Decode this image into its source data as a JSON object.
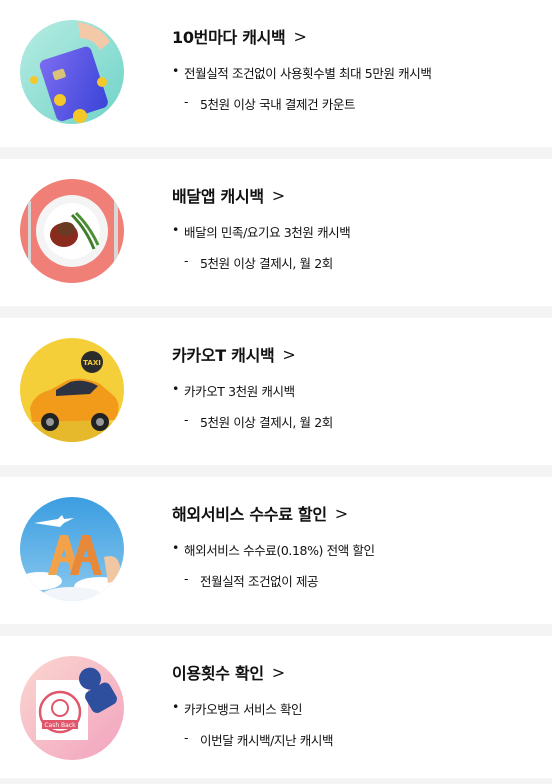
{
  "items": [
    {
      "title": "10번마다 캐시백",
      "chevron": ">",
      "bullet": "전월실적 조건없이 사용횟수별 최대 5만원 캐시백",
      "sub": "5천원 이상 국내 결제건 카운트",
      "icon": "card-cashback-icon"
    },
    {
      "title": "배달앱 캐시백",
      "chevron": ">",
      "bullet": "배달의 민족/요기요 3천원 캐시백",
      "sub": "5천원 이상 결제시, 월 2회",
      "icon": "food-plate-icon"
    },
    {
      "title": "카카오T 캐시백",
      "chevron": ">",
      "bullet": "카카오T 3천원 캐시백",
      "sub": "5천원 이상 결제시, 월 2회",
      "icon": "taxi-icon",
      "taxi_label": "TAXI"
    },
    {
      "title": "해외서비스 수수료 할인",
      "chevron": ">",
      "bullet": "해외서비스 수수료(0.18%) 전액 할인",
      "sub": "전월실적 조건없이 제공",
      "icon": "airplane-aa-icon"
    },
    {
      "title": "이용횟수 확인",
      "chevron": ">",
      "bullet": "카카오뱅크 서비스 확인",
      "sub": "이번달 캐시백/지난 캐시백",
      "icon": "cashback-stamp-icon",
      "stamp_label": "Cash Back"
    }
  ],
  "colors": {
    "card1_bg": "#8fe0d6",
    "card2_bg": "#f07f78",
    "card3_bg": "#f5cf3a",
    "card4_bg": "#4aa7e0",
    "card5_bg": "#f6b9c7"
  }
}
